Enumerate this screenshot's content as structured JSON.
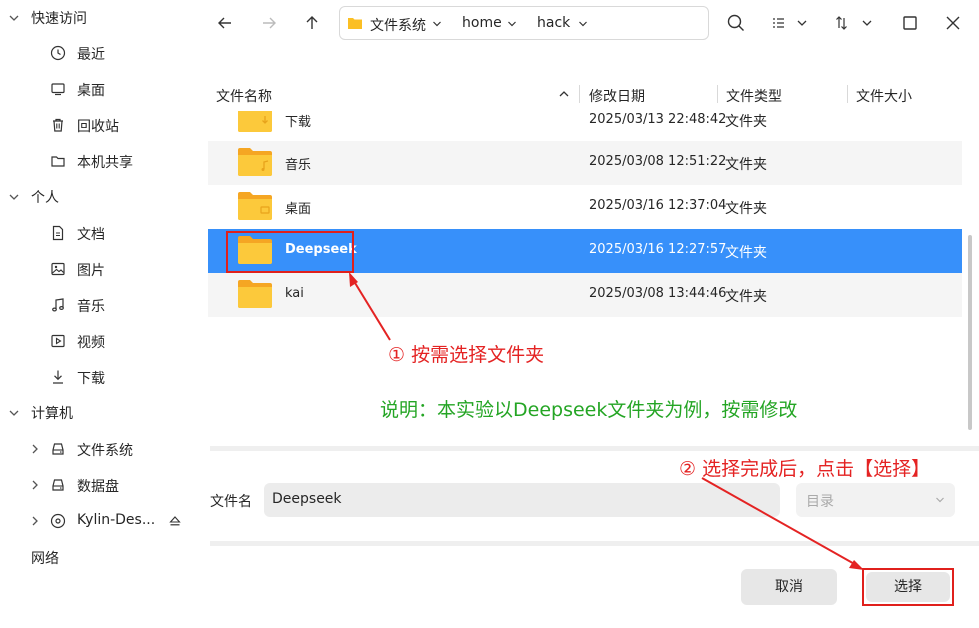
{
  "sidebar": {
    "quick_access": "快速访问",
    "quick_items": [
      "最近",
      "桌面",
      "回收站",
      "本机共享"
    ],
    "personal": "个人",
    "personal_items": [
      "文档",
      "图片",
      "音乐",
      "视频",
      "下载"
    ],
    "computer": "计算机",
    "computer_items": [
      "文件系统",
      "数据盘",
      "Kylin-Des..."
    ],
    "network": "网络"
  },
  "path": {
    "segments": [
      "文件系统",
      "home",
      "hack"
    ]
  },
  "columns": {
    "name": "文件名称",
    "modified": "修改日期",
    "type": "文件类型",
    "size": "文件大小"
  },
  "rows": [
    {
      "name": "下载",
      "date": "2025/03/13 22:48:42",
      "type": "文件夹"
    },
    {
      "name": "音乐",
      "date": "2025/03/08 12:51:22",
      "type": "文件夹"
    },
    {
      "name": "桌面",
      "date": "2025/03/16 12:37:04",
      "type": "文件夹"
    },
    {
      "name": "Deepseek",
      "date": "2025/03/16 12:27:57",
      "type": "文件夹"
    },
    {
      "name": "kai",
      "date": "2025/03/08 13:44:46",
      "type": "文件夹"
    }
  ],
  "file_name": {
    "label": "文件名",
    "value": "Deepseek"
  },
  "file_type": {
    "selected": "目录"
  },
  "buttons": {
    "cancel": "取消",
    "select": "选择"
  },
  "annotations": {
    "step1": "① 按需选择文件夹",
    "note": "说明：本实验以Deepseek文件夹为例，按需修改",
    "step2": "② 选择完成后，点击【选择】"
  },
  "colors": {
    "selected_row": "#3790fa",
    "annotation_red": "#e42323",
    "annotation_green": "#24a524",
    "folder": "#fbbf24"
  }
}
